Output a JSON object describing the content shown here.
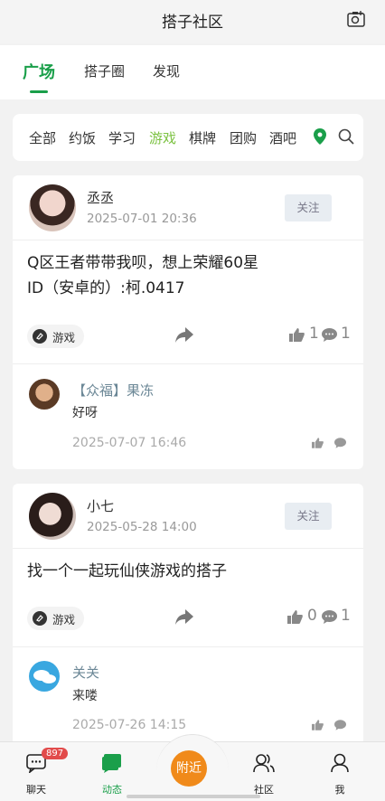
{
  "header": {
    "title": "搭子社区",
    "camera_icon": "camera-plus-icon"
  },
  "tabs": [
    {
      "label": "广场",
      "active": true
    },
    {
      "label": "搭子圈",
      "active": false
    },
    {
      "label": "发现",
      "active": false
    }
  ],
  "filters": [
    "全部",
    "约饭",
    "学习",
    "游戏",
    "棋牌",
    "团购",
    "酒吧"
  ],
  "active_filter": "游戏",
  "colors": {
    "accent": "#1a9f4a",
    "filter_active": "#7cc242",
    "nearby": "#f08a1a",
    "badge": "#e24b4b"
  },
  "posts": [
    {
      "user": "丞丞",
      "time": "2025-07-01 20:36",
      "follow_label": "关注",
      "content_line1": "Q区王者带带我呗，想上荣耀60星",
      "content_line2": "ID（安卓的）:柯.0417",
      "tag": "游戏",
      "likes": "1",
      "comments": "1",
      "reply": {
        "name": "【众福】果冻",
        "text": "好呀",
        "time": "2025-07-07 16:46"
      }
    },
    {
      "user": "小七",
      "time": "2025-05-28 14:00",
      "follow_label": "关注",
      "content_line1": "找一个一起玩仙侠游戏的搭子",
      "tag": "游戏",
      "likes": "0",
      "comments": "1",
      "reply": {
        "name": "关关",
        "text": "来喽",
        "time": "2025-07-26 14:15"
      }
    }
  ],
  "bottom_nav": [
    {
      "label": "聊天",
      "badge": "897"
    },
    {
      "label": "动态",
      "active": true
    },
    {
      "label": "附近"
    },
    {
      "label": "社区"
    },
    {
      "label": "我"
    }
  ]
}
